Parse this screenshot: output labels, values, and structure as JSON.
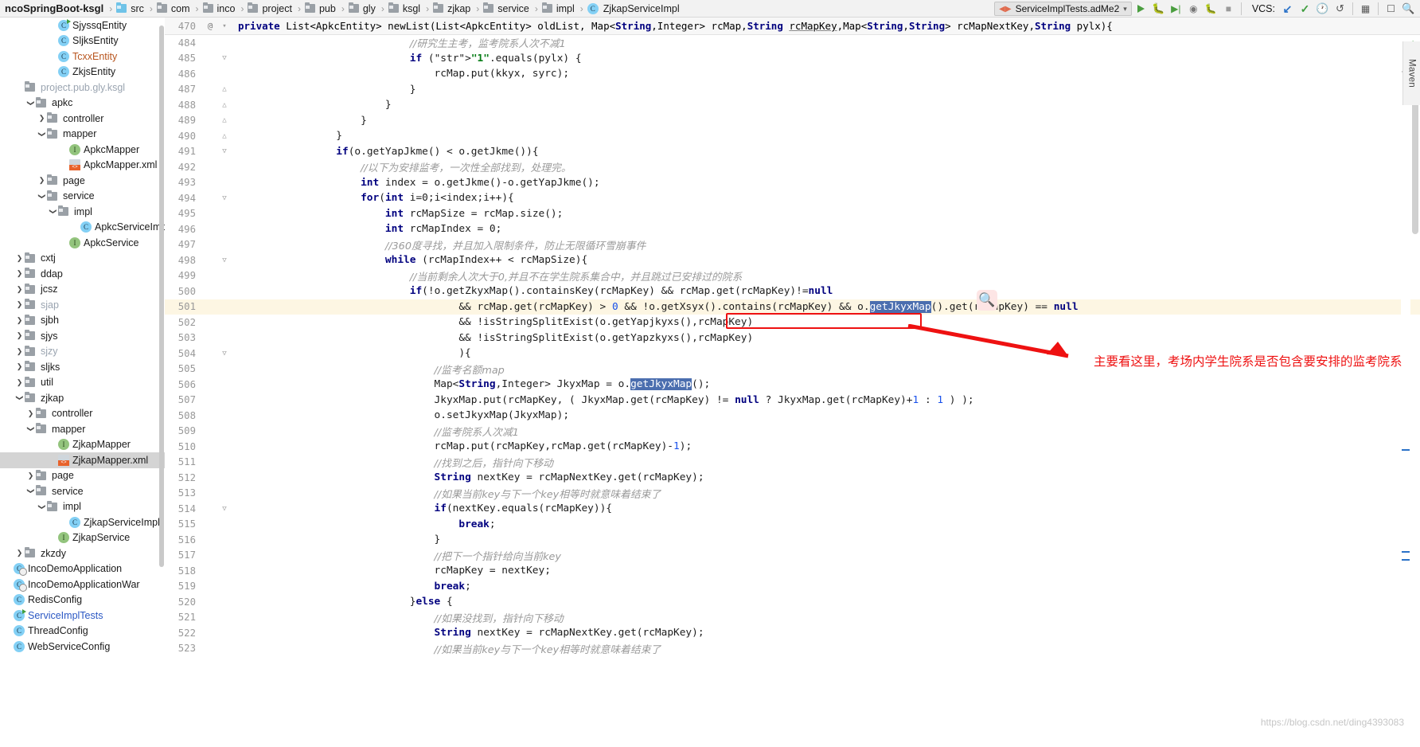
{
  "window": {
    "breadcrumb": [
      {
        "label": "ncoSpringBoot-ksgl",
        "icon": "none",
        "bold": true
      },
      {
        "label": "src",
        "icon": "folder-src"
      },
      {
        "label": "com",
        "icon": "folder"
      },
      {
        "label": "inco",
        "icon": "folder"
      },
      {
        "label": "project",
        "icon": "folder"
      },
      {
        "label": "pub",
        "icon": "folder"
      },
      {
        "label": "gly",
        "icon": "folder"
      },
      {
        "label": "ksgl",
        "icon": "folder"
      },
      {
        "label": "zjkap",
        "icon": "folder"
      },
      {
        "label": "service",
        "icon": "folder"
      },
      {
        "label": "impl",
        "icon": "folder"
      },
      {
        "label": "ZjkapServiceImpl",
        "icon": "class"
      }
    ],
    "run_config": "ServiceImplTests.adMe2",
    "vcs_label": "VCS:",
    "toolbar_icons": [
      "run-icon",
      "debug-icon",
      "run-coverage-icon",
      "profile-icon",
      "attach-debugger-icon",
      "stop-icon"
    ],
    "vcs_icons": [
      "update-project-icon",
      "commit-icon",
      "history-icon",
      "rollback-icon"
    ],
    "right_icons": [
      "structure-icon",
      "terminal-icon",
      "search-everywhere-icon"
    ],
    "maven_tab": "Maven"
  },
  "sidebar": {
    "scrollbar": "vertical-scrollbar",
    "items": [
      {
        "label": "SjyssqEntity",
        "indent": 4,
        "arrow": "none",
        "icon": "class-run",
        "style": "normal"
      },
      {
        "label": "SljksEntity",
        "indent": 4,
        "arrow": "none",
        "icon": "class",
        "style": "normal"
      },
      {
        "label": "TcxxEntity",
        "indent": 4,
        "arrow": "none",
        "icon": "class",
        "style": "orange"
      },
      {
        "label": "ZkjsEntity",
        "indent": 4,
        "arrow": "none",
        "icon": "class",
        "style": "normal"
      },
      {
        "label": "project.pub.gly.ksgl",
        "indent": 1,
        "arrow": "none",
        "icon": "folder",
        "style": "muted"
      },
      {
        "label": "apkc",
        "indent": 2,
        "arrow": "down",
        "icon": "folder",
        "style": "normal"
      },
      {
        "label": "controller",
        "indent": 3,
        "arrow": "right",
        "icon": "folder",
        "style": "normal"
      },
      {
        "label": "mapper",
        "indent": 3,
        "arrow": "down",
        "icon": "folder",
        "style": "normal"
      },
      {
        "label": "ApkcMapper",
        "indent": 5,
        "arrow": "none",
        "icon": "interface",
        "style": "normal"
      },
      {
        "label": "ApkcMapper.xml",
        "indent": 5,
        "arrow": "none",
        "icon": "xml",
        "style": "normal"
      },
      {
        "label": "page",
        "indent": 3,
        "arrow": "right",
        "icon": "folder",
        "style": "normal"
      },
      {
        "label": "service",
        "indent": 3,
        "arrow": "down",
        "icon": "folder",
        "style": "normal"
      },
      {
        "label": "impl",
        "indent": 4,
        "arrow": "down",
        "icon": "folder",
        "style": "normal"
      },
      {
        "label": "ApkcServiceImpl",
        "indent": 6,
        "arrow": "none",
        "icon": "class",
        "style": "normal"
      },
      {
        "label": "ApkcService",
        "indent": 5,
        "arrow": "none",
        "icon": "interface",
        "style": "normal"
      },
      {
        "label": "cxtj",
        "indent": 1,
        "arrow": "right",
        "icon": "folder",
        "style": "normal"
      },
      {
        "label": "ddap",
        "indent": 1,
        "arrow": "right",
        "icon": "folder",
        "style": "normal"
      },
      {
        "label": "jcsz",
        "indent": 1,
        "arrow": "right",
        "icon": "folder",
        "style": "normal"
      },
      {
        "label": "sjap",
        "indent": 1,
        "arrow": "right",
        "icon": "folder",
        "style": "muted"
      },
      {
        "label": "sjbh",
        "indent": 1,
        "arrow": "right",
        "icon": "folder",
        "style": "normal"
      },
      {
        "label": "sjys",
        "indent": 1,
        "arrow": "right",
        "icon": "folder",
        "style": "normal"
      },
      {
        "label": "sjzy",
        "indent": 1,
        "arrow": "right",
        "icon": "folder",
        "style": "muted"
      },
      {
        "label": "sljks",
        "indent": 1,
        "arrow": "right",
        "icon": "folder",
        "style": "normal"
      },
      {
        "label": "util",
        "indent": 1,
        "arrow": "right",
        "icon": "folder",
        "style": "normal"
      },
      {
        "label": "zjkap",
        "indent": 1,
        "arrow": "down",
        "icon": "folder",
        "style": "normal"
      },
      {
        "label": "controller",
        "indent": 2,
        "arrow": "right",
        "icon": "folder",
        "style": "normal"
      },
      {
        "label": "mapper",
        "indent": 2,
        "arrow": "down",
        "icon": "folder",
        "style": "normal"
      },
      {
        "label": "ZjkapMapper",
        "indent": 4,
        "arrow": "none",
        "icon": "interface",
        "style": "normal"
      },
      {
        "label": "ZjkapMapper.xml",
        "indent": 4,
        "arrow": "none",
        "icon": "xml",
        "style": "normal",
        "selected": true
      },
      {
        "label": "page",
        "indent": 2,
        "arrow": "right",
        "icon": "folder",
        "style": "normal"
      },
      {
        "label": "service",
        "indent": 2,
        "arrow": "down",
        "icon": "folder",
        "style": "normal"
      },
      {
        "label": "impl",
        "indent": 3,
        "arrow": "down",
        "icon": "folder",
        "style": "normal"
      },
      {
        "label": "ZjkapServiceImpl",
        "indent": 5,
        "arrow": "none",
        "icon": "class",
        "style": "normal"
      },
      {
        "label": "ZjkapService",
        "indent": 4,
        "arrow": "none",
        "icon": "interface",
        "style": "normal"
      },
      {
        "label": "zkzdy",
        "indent": 1,
        "arrow": "right",
        "icon": "folder",
        "style": "normal"
      },
      {
        "label": "IncoDemoApplication",
        "indent": 0,
        "arrow": "none",
        "icon": "class-app",
        "style": "normal"
      },
      {
        "label": "IncoDemoApplicationWar",
        "indent": 0,
        "arrow": "none",
        "icon": "class-app2",
        "style": "normal"
      },
      {
        "label": "RedisConfig",
        "indent": 0,
        "arrow": "none",
        "icon": "class",
        "style": "normal"
      },
      {
        "label": "ServiceImplTests",
        "indent": 0,
        "arrow": "none",
        "icon": "class-run",
        "style": "blue"
      },
      {
        "label": "ThreadConfig",
        "indent": 0,
        "arrow": "none",
        "icon": "class",
        "style": "normal"
      },
      {
        "label": "WebServiceConfig",
        "indent": 0,
        "arrow": "none",
        "icon": "class",
        "style": "normal"
      }
    ]
  },
  "editor": {
    "sticky_line_number": "470",
    "sticky_gutter_mark": "@",
    "sticky_code": "private List<ApkcEntity> newList(List<ApkcEntity> oldList, Map<String,Integer> rcMap,String rcMapKey,Map<String,String> rcMapNextKey,String pylx){",
    "toolbar_icons": [
      "back-icon",
      "forward-icon",
      "sort-icon",
      "settings-icon",
      "collapse-icon"
    ],
    "first_line": 484,
    "lines": [
      {
        "n": 484,
        "fold": "",
        "indent": 7,
        "text": "//研究生主考，监考院系人次不减1",
        "cls": "cmt-cn"
      },
      {
        "n": 485,
        "fold": "v",
        "indent": 7,
        "text": "if (\"1\".equals(pylx) {"
      },
      {
        "n": 486,
        "fold": "",
        "indent": 8,
        "text": "rcMap.put(kkyx, syrc);"
      },
      {
        "n": 487,
        "fold": "^",
        "indent": 7,
        "text": "}"
      },
      {
        "n": 488,
        "fold": "^",
        "indent": 6,
        "text": "}"
      },
      {
        "n": 489,
        "fold": "^",
        "indent": 5,
        "text": "}"
      },
      {
        "n": 490,
        "fold": "^",
        "indent": 4,
        "text": "}"
      },
      {
        "n": 491,
        "fold": "v",
        "indent": 4,
        "text": "if(o.getYapJkme() < o.getJkme()){"
      },
      {
        "n": 492,
        "fold": "",
        "indent": 5,
        "text": "//以下为安排监考，一次性全部找到，处理完。",
        "cls": "cmt-cn"
      },
      {
        "n": 493,
        "fold": "",
        "indent": 5,
        "text": "int index = o.getJkme()-o.getYapJkme();"
      },
      {
        "n": 494,
        "fold": "v",
        "indent": 5,
        "text": "for(int i=0;i<index;i++){"
      },
      {
        "n": 495,
        "fold": "",
        "indent": 6,
        "text": "int rcMapSize = rcMap.size();"
      },
      {
        "n": 496,
        "fold": "",
        "indent": 6,
        "text": "int rcMapIndex = 0;"
      },
      {
        "n": 497,
        "fold": "",
        "indent": 6,
        "text": "//360度寻找，并且加入限制条件，防止无限循环雪崩事件",
        "cls": "cmt-cn"
      },
      {
        "n": 498,
        "fold": "v",
        "indent": 6,
        "text": "while (rcMapIndex++ < rcMapSize){"
      },
      {
        "n": 499,
        "fold": "",
        "indent": 7,
        "text": "//当前剩余人次大于0,并且不在学生院系集合中，并且跳过已安排过的院系",
        "cls": "cmt-cn"
      },
      {
        "n": 500,
        "fold": "",
        "indent": 7,
        "text": "if(!o.getZkyxMap().containsKey(rcMapKey) && rcMap.get(rcMapKey)!=null"
      },
      {
        "n": 501,
        "fold": "",
        "indent": 9,
        "text": "&& rcMap.get(rcMapKey) > 0 && !o.getXsyx().contains(rcMapKey) && o.getJkyxMap().get(rcMapKey) == null",
        "highlight": true
      },
      {
        "n": 502,
        "fold": "",
        "indent": 9,
        "text": "&& !isStringSplitExist(o.getYapjkyxs(),rcMapKey)"
      },
      {
        "n": 503,
        "fold": "",
        "indent": 9,
        "text": "&& !isStringSplitExist(o.getYapzkyxs(),rcMapKey)"
      },
      {
        "n": 504,
        "fold": "v",
        "indent": 9,
        "text": "){"
      },
      {
        "n": 505,
        "fold": "",
        "indent": 8,
        "text": "//监考名额map",
        "cls": "cmt-cn"
      },
      {
        "n": 506,
        "fold": "",
        "indent": 8,
        "text": "Map<String,Integer> JkyxMap = o.getJkyxMap();"
      },
      {
        "n": 507,
        "fold": "",
        "indent": 8,
        "text": "JkyxMap.put(rcMapKey, ( JkyxMap.get(rcMapKey) != null ? JkyxMap.get(rcMapKey)+1 : 1 ) );"
      },
      {
        "n": 508,
        "fold": "",
        "indent": 8,
        "text": "o.setJkyxMap(JkyxMap);"
      },
      {
        "n": 509,
        "fold": "",
        "indent": 8,
        "text": "//监考院系人次减1",
        "cls": "cmt-cn"
      },
      {
        "n": 510,
        "fold": "",
        "indent": 8,
        "text": "rcMap.put(rcMapKey,rcMap.get(rcMapKey)-1);"
      },
      {
        "n": 511,
        "fold": "",
        "indent": 8,
        "text": "//找到之后，指针向下移动",
        "cls": "cmt-cn"
      },
      {
        "n": 512,
        "fold": "",
        "indent": 8,
        "text": "String nextKey = rcMapNextKey.get(rcMapKey);"
      },
      {
        "n": 513,
        "fold": "",
        "indent": 8,
        "text": "//如果当前key与下一个key相等时就意味着结束了",
        "cls": "cmt-cn"
      },
      {
        "n": 514,
        "fold": "v",
        "indent": 8,
        "text": "if(nextKey.equals(rcMapKey)){"
      },
      {
        "n": 515,
        "fold": "",
        "indent": 9,
        "text": "break;"
      },
      {
        "n": 516,
        "fold": "",
        "indent": 8,
        "text": "}"
      },
      {
        "n": 517,
        "fold": "",
        "indent": 8,
        "text": "//把下一个指针给向当前key",
        "cls": "cmt-cn"
      },
      {
        "n": 518,
        "fold": "",
        "indent": 8,
        "text": "rcMapKey = nextKey;"
      },
      {
        "n": 519,
        "fold": "",
        "indent": 8,
        "text": "break;"
      },
      {
        "n": 520,
        "fold": "",
        "indent": 7,
        "text": "}else {"
      },
      {
        "n": 521,
        "fold": "",
        "indent": 8,
        "text": "//如果没找到，指针向下移动",
        "cls": "cmt-cn"
      },
      {
        "n": 522,
        "fold": "",
        "indent": 8,
        "text": "String nextKey = rcMapNextKey.get(rcMapKey);"
      },
      {
        "n": 523,
        "fold": "",
        "indent": 8,
        "text": "//如果当前key与下一个key相等时就意味着结束了",
        "cls": "cmt-cn"
      }
    ]
  },
  "annotation": {
    "text": "主要看这里，考场内学生院系是否包含要安排的监考院系",
    "color": "#ee1111",
    "box_target": "&& !o.getXsyx().contains(rcMapKey)"
  },
  "watermark": {
    "url": "https://blog.csdn.net/ding4393083"
  }
}
